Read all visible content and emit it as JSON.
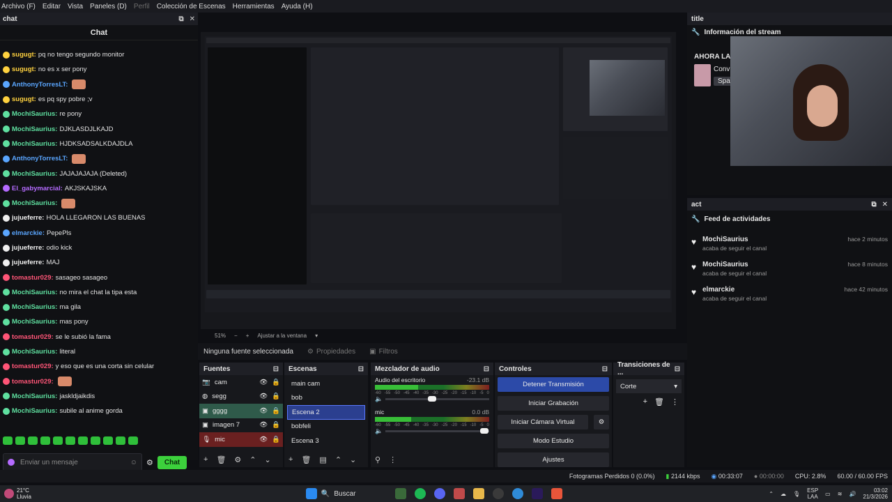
{
  "menu": [
    "Archivo (F)",
    "Editar",
    "Vista",
    "Paneles (D)",
    "Perfil",
    "Colección de Escenas",
    "Herramientas",
    "Ayuda (H)"
  ],
  "chat_dock": {
    "title": "chat",
    "header": "Chat",
    "lines": [
      {
        "user": "sugugt:",
        "msg": "pq no tengo segundo monitor",
        "color": "#ffd23f"
      },
      {
        "user": "sugugt:",
        "msg": "no es x ser pony",
        "color": "#ffd23f"
      },
      {
        "user": "AnthonyTorresLT:",
        "msg": "",
        "color": "#5aa6ff"
      },
      {
        "user": "sugugt:",
        "msg": "es pq spy pobre ;v",
        "color": "#ffd23f"
      },
      {
        "user": "MochiSaurius:",
        "msg": "re pony",
        "color": "#5fe0a0"
      },
      {
        "user": "MochiSaurius:",
        "msg": "DJKLASDJLKAJD",
        "color": "#5fe0a0"
      },
      {
        "user": "MochiSaurius:",
        "msg": "HJDKSADSALKDAJDLA",
        "color": "#5fe0a0"
      },
      {
        "user": "AnthonyTorresLT:",
        "msg": "",
        "color": "#5aa6ff"
      },
      {
        "user": "MochiSaurius:",
        "msg": "JAJAJAJAJA (Deleted)",
        "color": "#5fe0a0"
      },
      {
        "user": "El_gabymarcial:",
        "msg": "AKJSKAJSKA",
        "color": "#b56bff"
      },
      {
        "user": "MochiSaurius:",
        "msg": "",
        "color": "#5fe0a0"
      },
      {
        "user": "jujueferre:",
        "msg": "HOLA LLEGARON LAS BUENAS",
        "color": "#f0f0f0"
      },
      {
        "user": "elmarckie:",
        "msg": "PepePls",
        "color": "#5aa6ff"
      },
      {
        "user": "jujueferre:",
        "msg": "odio kick",
        "color": "#f0f0f0"
      },
      {
        "user": "jujueferre:",
        "msg": "MAJ",
        "color": "#f0f0f0"
      },
      {
        "user": "tomastur029:",
        "msg": "sasageo sasageo",
        "color": "#ff5577"
      },
      {
        "user": "MochiSaurius:",
        "msg": "no mira el chat la tipa esta",
        "color": "#5fe0a0"
      },
      {
        "user": "MochiSaurius:",
        "msg": "ma gila",
        "color": "#5fe0a0"
      },
      {
        "user": "MochiSaurius:",
        "msg": "mas pony",
        "color": "#5fe0a0"
      },
      {
        "user": "tomastur029:",
        "msg": "se le subió la fama",
        "color": "#ff5577"
      },
      {
        "user": "MochiSaurius:",
        "msg": "literal",
        "color": "#5fe0a0"
      },
      {
        "user": "tomastur029:",
        "msg": "y eso que es una corta sin celular",
        "color": "#ff5577"
      },
      {
        "user": "tomastur029:",
        "msg": "",
        "color": "#ff5577"
      },
      {
        "user": "MochiSaurius:",
        "msg": "jaskldjaikdis",
        "color": "#5fe0a0"
      },
      {
        "user": "MochiSaurius:",
        "msg": "subile al anime gorda",
        "color": "#5fe0a0"
      }
    ],
    "input_placeholder": "Enviar un mensaje",
    "send_label": "Chat"
  },
  "preview": {
    "zoom": "51%",
    "fit_label": "Ajustar a la ventana"
  },
  "source_bar": {
    "selected": "Ninguna fuente seleccionada",
    "properties": "Propiedades",
    "filters": "Filtros"
  },
  "sources": {
    "title": "Fuentes",
    "items": [
      {
        "name": "cam",
        "icon": "camera-icon"
      },
      {
        "name": "segg",
        "icon": "globe-icon"
      },
      {
        "name": "gggg",
        "icon": "image-icon"
      },
      {
        "name": "imagen 7",
        "icon": "image-icon"
      },
      {
        "name": "mic",
        "icon": "mic-icon"
      }
    ]
  },
  "scenes": {
    "title": "Escenas",
    "items": [
      "main cam",
      "bob",
      "Escena 2",
      "bobfeli",
      "Escena 3"
    ],
    "selected": 2
  },
  "mixer": {
    "title": "Mezclador de audio",
    "channels": [
      {
        "name": "Audio del escritorio",
        "db": "-23.1 dB",
        "level": 0.38,
        "volume": 0.45
      },
      {
        "name": "mic",
        "db": "0.0 dB",
        "level": 0.32,
        "volume": 0.95
      }
    ],
    "scale": [
      "-60",
      "-55",
      "-50",
      "-45",
      "-40",
      "-35",
      "-30",
      "-25",
      "-20",
      "-15",
      "-10",
      "-5",
      "0"
    ]
  },
  "controls": {
    "title": "Controles",
    "buttons": [
      "Detener Transmisión",
      "Iniciar Grabación",
      "Iniciar Cámara Virtual",
      "Modo Estudio",
      "Ajustes"
    ]
  },
  "transitions": {
    "title": "Transiciones de ...",
    "value": "Corte"
  },
  "title_dock": {
    "title": "title",
    "section": "Información del stream",
    "now_label": "AHORA LA",
    "conv": "Conv",
    "spa": "Spa"
  },
  "act_dock": {
    "title": "act",
    "section": "Feed de actividades",
    "items": [
      {
        "name": "MochiSaurius",
        "sub": "acaba de seguir el canal",
        "time": "hace 2 minutos"
      },
      {
        "name": "MochiSaurius",
        "sub": "acaba de seguir el canal",
        "time": "hace 8 minutos"
      },
      {
        "name": "elmarckie",
        "sub": "acaba de seguir el canal",
        "time": "hace 42 minutos"
      }
    ]
  },
  "status": {
    "frames": "Fotogramas Perdidos 0 (0.0%)",
    "bitrate": "2144 kbps",
    "stream_time": "00:33:07",
    "rec_time": "00:00:00",
    "cpu": "CPU: 2.8%",
    "fps": "60.00 / 60.00 FPS"
  },
  "taskbar": {
    "temp": "21°C",
    "weather": "Lluvia",
    "search": "Buscar",
    "lang": "ESP",
    "lang2": "LAA",
    "time": "03:02",
    "date": "21/3/2026"
  },
  "colors": {
    "accent": "#2c4aa8",
    "green": "#3cd13c"
  }
}
